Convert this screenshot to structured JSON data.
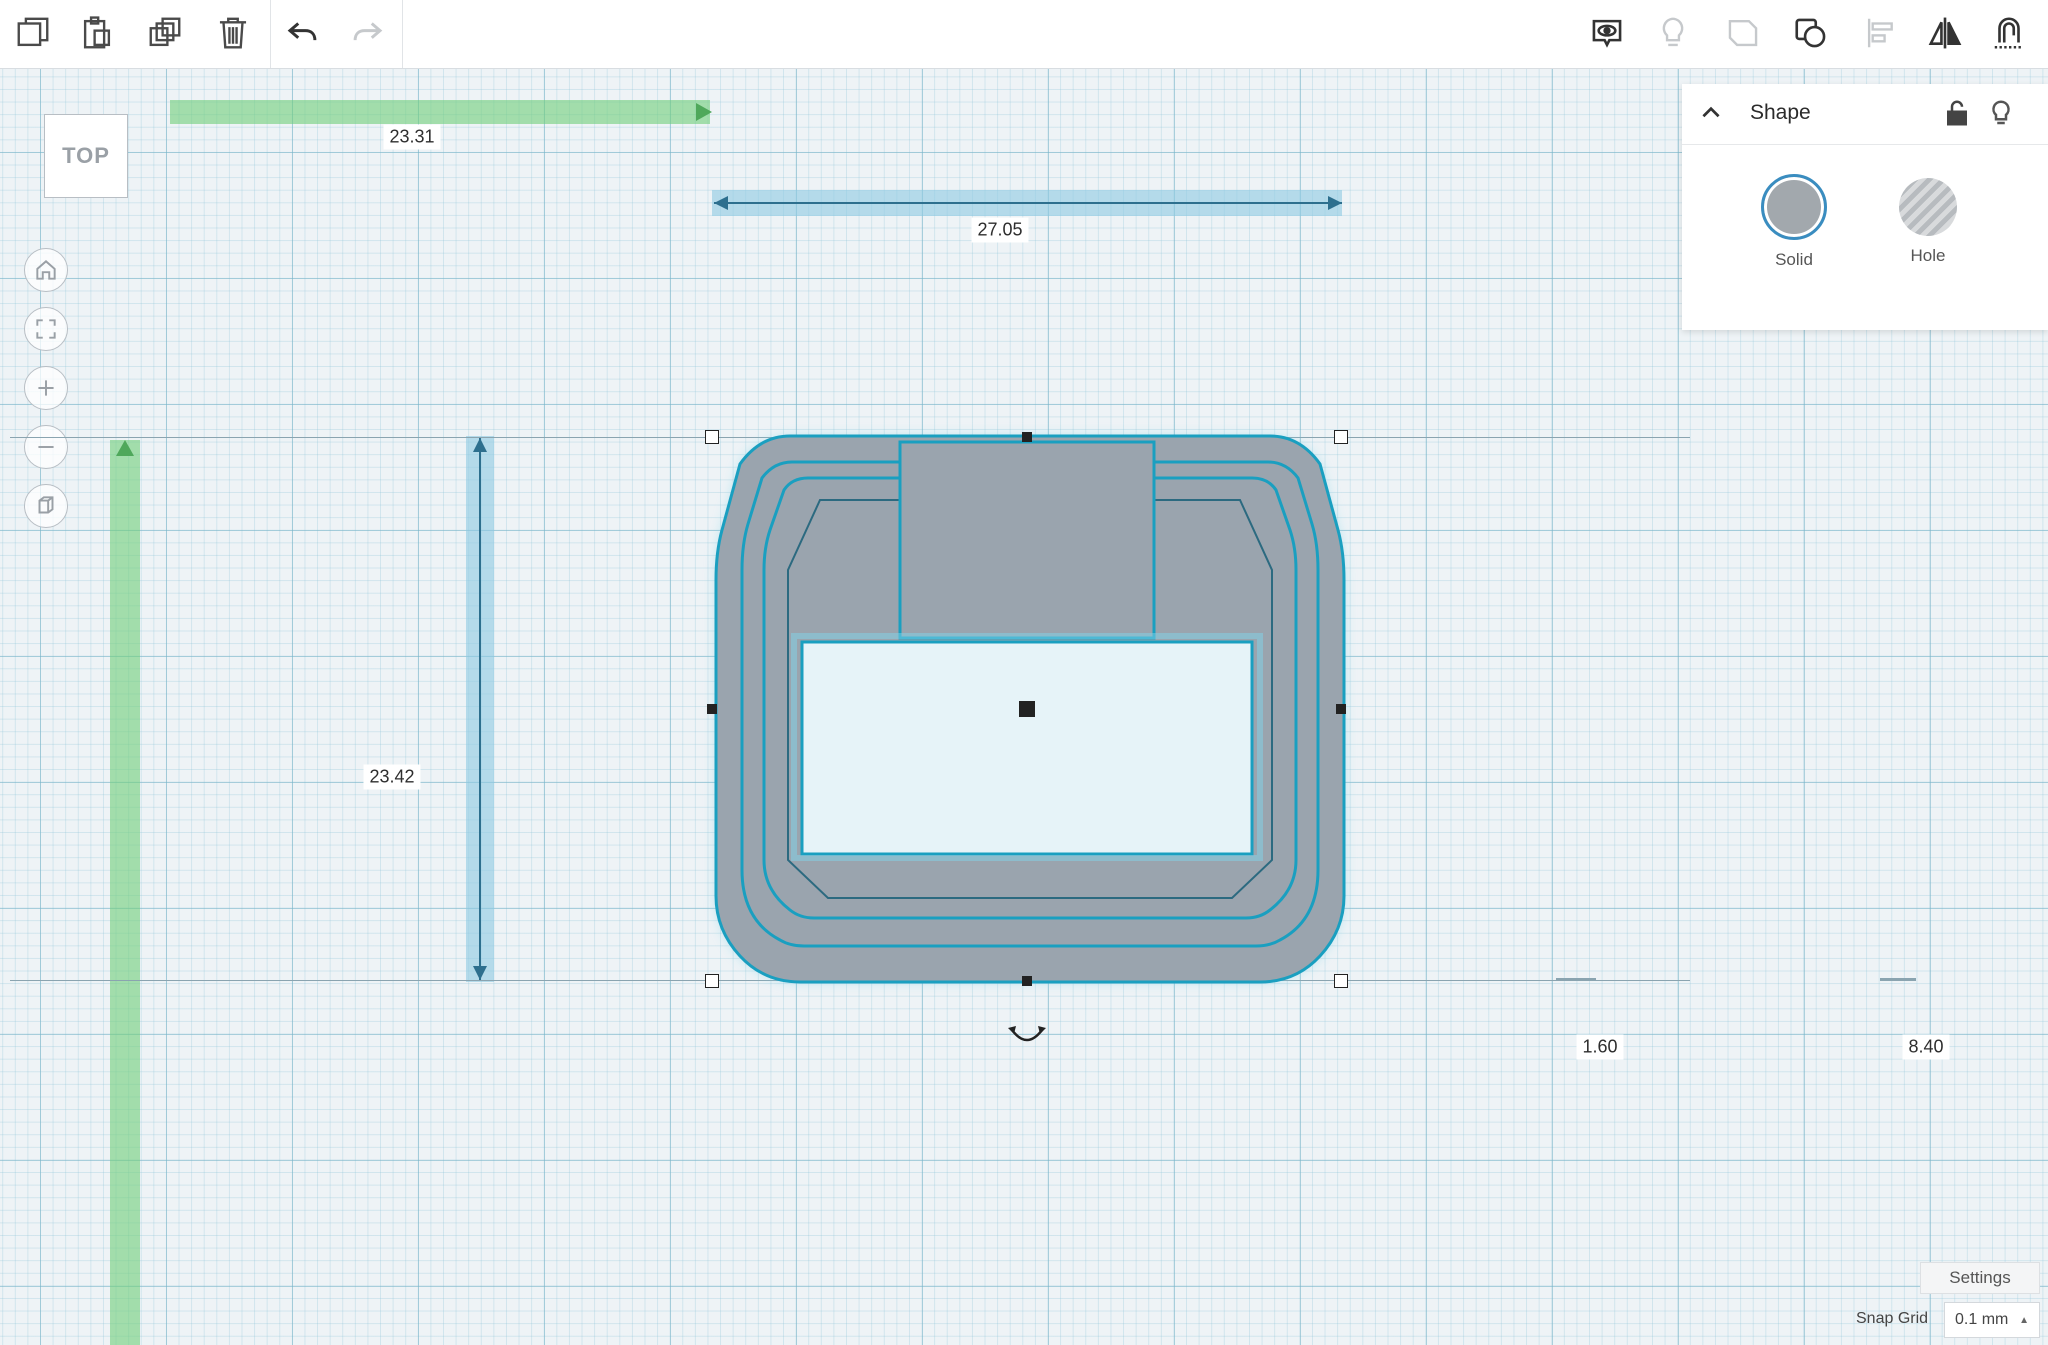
{
  "toolbar": {
    "left": [
      {
        "icon": "copy-icon"
      },
      {
        "icon": "paste-icon"
      },
      {
        "icon": "duplicate-icon"
      },
      {
        "icon": "delete-icon"
      },
      {
        "icon": "undo-icon"
      },
      {
        "icon": "redo-icon"
      }
    ],
    "right": [
      {
        "icon": "show-all-icon"
      },
      {
        "icon": "bulb-icon"
      },
      {
        "icon": "group-icon"
      },
      {
        "icon": "ungroup-icon"
      },
      {
        "icon": "align-icon"
      },
      {
        "icon": "mirror-icon"
      },
      {
        "icon": "cruise-icon"
      }
    ]
  },
  "viewcube": {
    "label": "TOP"
  },
  "navigation": [
    {
      "icon": "home-icon"
    },
    {
      "icon": "fit-view-icon"
    },
    {
      "icon": "zoom-in-icon"
    },
    {
      "icon": "zoom-out-icon"
    },
    {
      "icon": "perspective-icon"
    }
  ],
  "dimensions": {
    "green_horizontal": "23.31",
    "blue_horizontal": "27.05",
    "blue_vertical": "23.42",
    "height": "1.60",
    "elevation": "8.40"
  },
  "shape_panel": {
    "title": "Shape",
    "solid_label": "Solid",
    "hole_label": "Hole"
  },
  "footer": {
    "settings_label": "Settings",
    "snap_label": "Snap Grid",
    "snap_value": "0.1 mm"
  },
  "colors": {
    "shape_fill": "#9aa4ae",
    "outline": "#1a9fc0",
    "green_ruler": "#6fce7a",
    "blue_ruler": "#8ec9e3"
  }
}
